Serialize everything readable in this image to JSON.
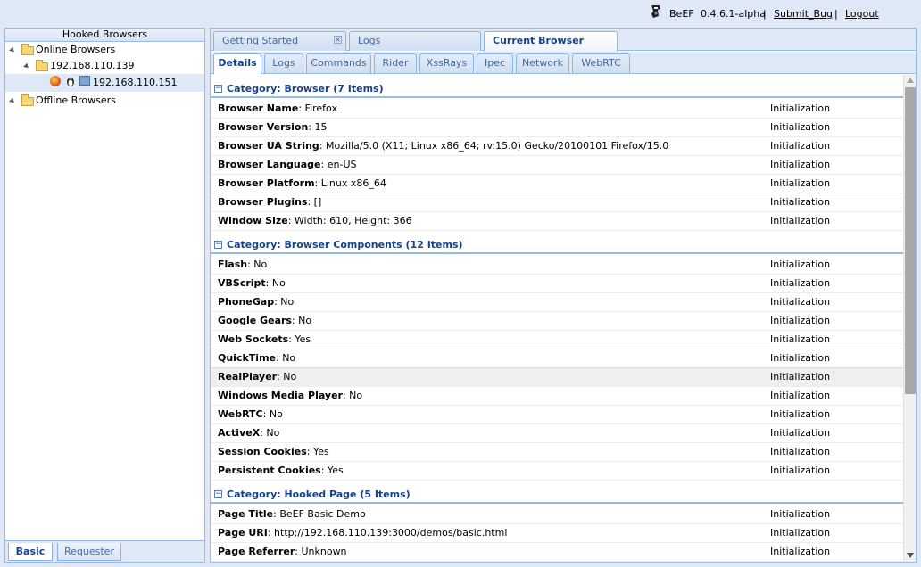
{
  "header": {
    "brand": "BeEF",
    "version": "0.4.6.1-alpha",
    "separator": "|",
    "submit_bug": "Submit_Bug",
    "logout": "Logout",
    "logo_icon": "beef-logo-icon"
  },
  "left_panel": {
    "title": "Hooked Browsers",
    "tree": {
      "online": "Online Browsers",
      "subnet": "192.168.110.139",
      "browser_ip": "192.168.110.151",
      "offline": "Offline Browsers"
    },
    "tabs": [
      "Basic",
      "Requester"
    ]
  },
  "main_tabs": [
    "Getting Started",
    "Logs",
    "Current Browser"
  ],
  "sub_tabs": [
    "Details",
    "Logs",
    "Commands",
    "Rider",
    "XssRays",
    "Ipec",
    "Network",
    "WebRTC"
  ],
  "categories": [
    {
      "title": "Category: Browser (7 Items)",
      "rows": [
        {
          "key": "Browser Name",
          "value": ": Firefox",
          "source": "Initialization"
        },
        {
          "key": "Browser Version",
          "value": ": 15",
          "source": "Initialization"
        },
        {
          "key": "Browser UA String",
          "value": ": Mozilla/5.0 (X11; Linux x86_64; rv:15.0) Gecko/20100101 Firefox/15.0",
          "source": "Initialization"
        },
        {
          "key": "Browser Language",
          "value": ": en-US",
          "source": "Initialization"
        },
        {
          "key": "Browser Platform",
          "value": ": Linux x86_64",
          "source": "Initialization"
        },
        {
          "key": "Browser Plugins",
          "value": ": []",
          "source": "Initialization"
        },
        {
          "key": "Window Size",
          "value": ": Width: 610, Height: 366",
          "source": "Initialization"
        }
      ]
    },
    {
      "title": "Category: Browser Components (12 Items)",
      "rows": [
        {
          "key": "Flash",
          "value": ": No",
          "source": "Initialization"
        },
        {
          "key": "VBScript",
          "value": ": No",
          "source": "Initialization"
        },
        {
          "key": "PhoneGap",
          "value": ": No",
          "source": "Initialization"
        },
        {
          "key": "Google Gears",
          "value": ": No",
          "source": "Initialization"
        },
        {
          "key": "Web Sockets",
          "value": ": Yes",
          "source": "Initialization"
        },
        {
          "key": "QuickTime",
          "value": ": No",
          "source": "Initialization"
        },
        {
          "key": "RealPlayer",
          "value": ": No",
          "source": "Initialization"
        },
        {
          "key": "Windows Media Player",
          "value": ": No",
          "source": "Initialization"
        },
        {
          "key": "WebRTC",
          "value": ": No",
          "source": "Initialization"
        },
        {
          "key": "ActiveX",
          "value": ": No",
          "source": "Initialization"
        },
        {
          "key": "Session Cookies",
          "value": ": Yes",
          "source": "Initialization"
        },
        {
          "key": "Persistent Cookies",
          "value": ": Yes",
          "source": "Initialization"
        }
      ]
    },
    {
      "title": "Category: Hooked Page (5 Items)",
      "rows": [
        {
          "key": "Page Title",
          "value": ": BeEF Basic Demo",
          "source": "Initialization"
        },
        {
          "key": "Page URI",
          "value": ": http://192.168.110.139:3000/demos/basic.html",
          "source": "Initialization"
        },
        {
          "key": "Page Referrer",
          "value": ": Unknown",
          "source": "Initialization"
        }
      ]
    }
  ]
}
